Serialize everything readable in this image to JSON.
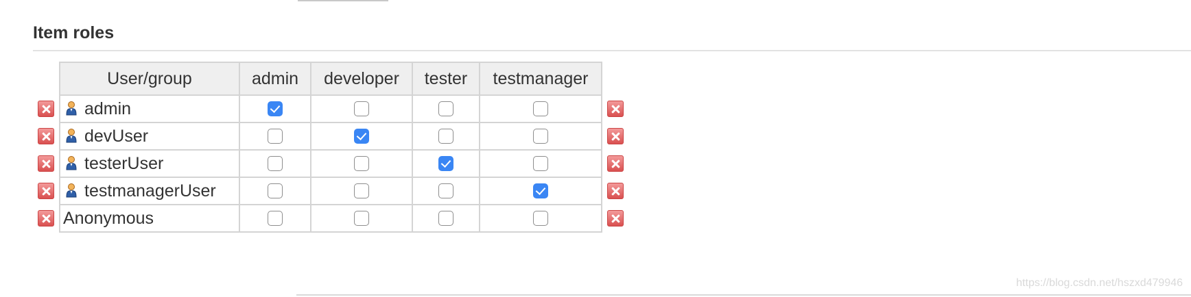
{
  "section": {
    "title": "Item roles"
  },
  "table": {
    "headers": {
      "user_group": "User/group",
      "admin": "admin",
      "developer": "developer",
      "tester": "tester",
      "testmanager": "testmanager"
    },
    "rows": [
      {
        "name": "admin",
        "type": "user",
        "admin": true,
        "developer": false,
        "tester": false,
        "testmanager": false
      },
      {
        "name": "devUser",
        "type": "user",
        "admin": false,
        "developer": true,
        "tester": false,
        "testmanager": false
      },
      {
        "name": "testerUser",
        "type": "user",
        "admin": false,
        "developer": false,
        "tester": true,
        "testmanager": false
      },
      {
        "name": "testmanagerUser",
        "type": "user",
        "admin": false,
        "developer": false,
        "tester": false,
        "testmanager": true
      },
      {
        "name": "Anonymous",
        "type": "anonymous",
        "admin": false,
        "developer": false,
        "tester": false,
        "testmanager": false
      }
    ]
  },
  "icons": {
    "row_delete": "delete-icon",
    "user": "user-icon"
  },
  "colors": {
    "checkbox_checked": "#3a86f4",
    "delete_button": "#d95050"
  },
  "watermark": "https://blog.csdn.net/hszxd479946"
}
